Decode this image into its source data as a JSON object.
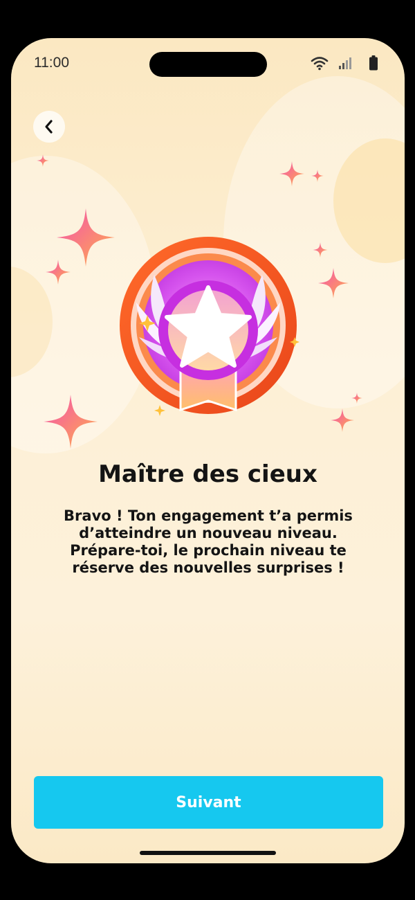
{
  "status_bar": {
    "time": "11:00",
    "icons": [
      "wifi-icon",
      "cellular-signal-icon",
      "battery-icon"
    ]
  },
  "navigation": {
    "back_icon": "chevron-left-icon"
  },
  "badge": {
    "icon": "star-medal-badge",
    "colors": {
      "ring": "#f1541c",
      "inner": "#d24ff0",
      "star": "#ffffff",
      "ribbon": "#f59a3c"
    }
  },
  "content": {
    "title": "Maître des cieux",
    "message_lines": [
      "Bravo ! Ton engagement t’a permis",
      "d’atteindre un nouveau niveau.",
      "Prépare-toi, le prochain niveau te",
      "réserve des nouvelles surprises !"
    ]
  },
  "actions": {
    "next_label": "Suivant"
  },
  "theme": {
    "background": "#fdf0d6",
    "accent": "#16c8ef",
    "sparkle_from": "#f34fb0",
    "sparkle_to": "#ffb04a"
  }
}
